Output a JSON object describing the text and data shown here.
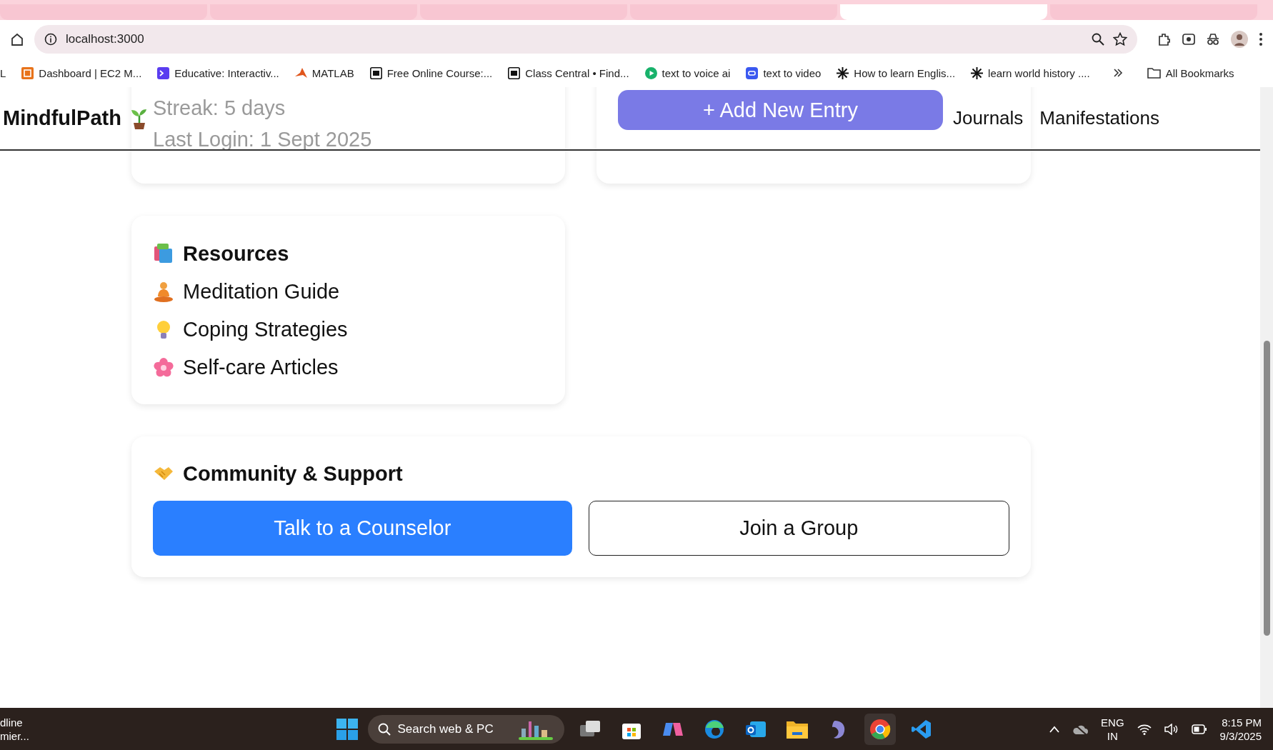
{
  "browser": {
    "tabs": [
      {
        "selected": false
      },
      {
        "selected": false
      },
      {
        "selected": false
      },
      {
        "selected": false
      },
      {
        "selected": true
      },
      {
        "selected": false
      }
    ],
    "address": "localhost:3000",
    "bookmarks": [
      {
        "label": "L",
        "kind": "none"
      },
      {
        "label": "Dashboard | EC2 M...",
        "kind": "cloud"
      },
      {
        "label": "Educative: Interactiv...",
        "kind": "terminal"
      },
      {
        "label": "MATLAB",
        "kind": "peak"
      },
      {
        "label": "Free Online Course:...",
        "kind": "cc"
      },
      {
        "label": "Class Central • Find...",
        "kind": "cc"
      },
      {
        "label": "text to voice ai",
        "kind": "play"
      },
      {
        "label": "text to video",
        "kind": "video"
      },
      {
        "label": "How to learn Englis...",
        "kind": "star"
      },
      {
        "label": "learn world history ....",
        "kind": "star"
      }
    ],
    "all_bookmarks": "All Bookmarks"
  },
  "header": {
    "logo": "MindfulPath",
    "nav": [
      "Journals",
      "Manifestations"
    ]
  },
  "stats_card": {
    "lines": [
      "Streak: 5 days",
      "Last Login: 1 Sept 2025"
    ]
  },
  "entry_card": {
    "button": "+ Add New Entry"
  },
  "resources": {
    "title": "Resources",
    "items": [
      {
        "label": "Meditation Guide",
        "kind": "meditation"
      },
      {
        "label": "Coping Strategies",
        "kind": "bulb"
      },
      {
        "label": "Self-care Articles",
        "kind": "flower"
      }
    ]
  },
  "community": {
    "title": "Community & Support",
    "buttons": [
      {
        "label": "Talk to a Counselor",
        "kind": "primary"
      },
      {
        "label": "Join a Group",
        "kind": "outline"
      }
    ]
  },
  "taskbar": {
    "widget": [
      "dline",
      "mier..."
    ],
    "search": "Search web & PC",
    "language": [
      "ENG",
      "IN"
    ],
    "time": "8:15 PM",
    "date": "9/3/2025"
  }
}
